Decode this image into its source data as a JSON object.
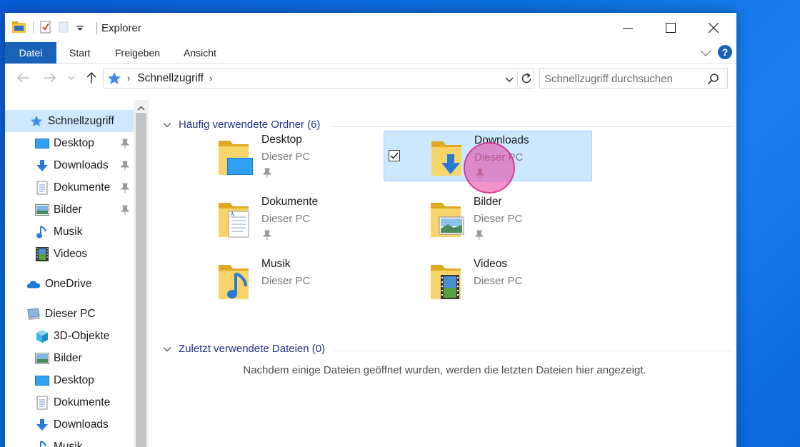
{
  "window": {
    "title": "Explorer"
  },
  "ribbon": {
    "tabs": [
      {
        "label": "Datei"
      },
      {
        "label": "Start"
      },
      {
        "label": "Freigeben"
      },
      {
        "label": "Ansicht"
      }
    ]
  },
  "address": {
    "crumbs": [
      "Schnellzugriff"
    ]
  },
  "search": {
    "placeholder": "Schnellzugriff durchsuchen"
  },
  "navpane": {
    "items": [
      {
        "label": "Schnellzugriff",
        "icon": "star-icon",
        "selected": true
      },
      {
        "label": "Desktop",
        "icon": "desktop-icon",
        "pinned": true
      },
      {
        "label": "Downloads",
        "icon": "download-arrow-icon",
        "pinned": true
      },
      {
        "label": "Dokumente",
        "icon": "document-icon",
        "pinned": true
      },
      {
        "label": "Bilder",
        "icon": "picture-icon",
        "pinned": true
      },
      {
        "label": "Musik",
        "icon": "music-note-icon"
      },
      {
        "label": "Videos",
        "icon": "film-icon"
      },
      {
        "label": "OneDrive",
        "icon": "cloud-icon"
      },
      {
        "label": "Dieser PC",
        "icon": "computer-icon"
      },
      {
        "label": "3D-Objekte",
        "icon": "cube-icon"
      },
      {
        "label": "Bilder",
        "icon": "picture-icon"
      },
      {
        "label": "Desktop",
        "icon": "desktop-icon"
      },
      {
        "label": "Dokumente",
        "icon": "document-icon"
      },
      {
        "label": "Downloads",
        "icon": "download-arrow-icon"
      },
      {
        "label": "Musik",
        "icon": "music-note-icon"
      }
    ]
  },
  "content": {
    "frequent_header": "Häufig verwendete Ordner (6)",
    "recent_header": "Zuletzt verwendete Dateien (0)",
    "empty_message": "Nachdem einige Dateien geöffnet wurden, werden die letzten Dateien hier angezeigt.",
    "folders": [
      {
        "name": "Desktop",
        "location": "Dieser PC",
        "pinned": true
      },
      {
        "name": "Downloads",
        "location": "Dieser PC",
        "pinned": true,
        "selected": true
      },
      {
        "name": "Dokumente",
        "location": "Dieser PC",
        "pinned": true
      },
      {
        "name": "Bilder",
        "location": "Dieser PC",
        "pinned": true
      },
      {
        "name": "Musik",
        "location": "Dieser PC"
      },
      {
        "name": "Videos",
        "location": "Dieser PC"
      }
    ]
  },
  "colors": {
    "accent": "#1a62b8",
    "selection": "#cce8ff",
    "group_header": "#1e3287",
    "desktop": "#0a5bd6",
    "click_marker": "#e63ca0"
  }
}
